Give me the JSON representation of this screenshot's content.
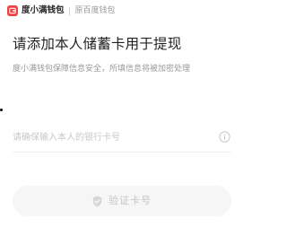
{
  "header": {
    "brand_name": "度小满钱包",
    "brand_subtitle": "原百度钱包",
    "logo_icon": "wallet-logo-icon",
    "accent_color": "#f04142"
  },
  "main": {
    "title": "请添加本人储蓄卡用于提现",
    "subtitle": "度小满钱包保障信息安全，所填信息将被加密处理"
  },
  "form": {
    "card_number": {
      "value": "",
      "placeholder": "请确保输入本人的银行卡号",
      "info_icon": "info-icon"
    },
    "verify_button": {
      "label": "验证卡号",
      "icon": "shield-icon",
      "state": "disabled"
    }
  }
}
